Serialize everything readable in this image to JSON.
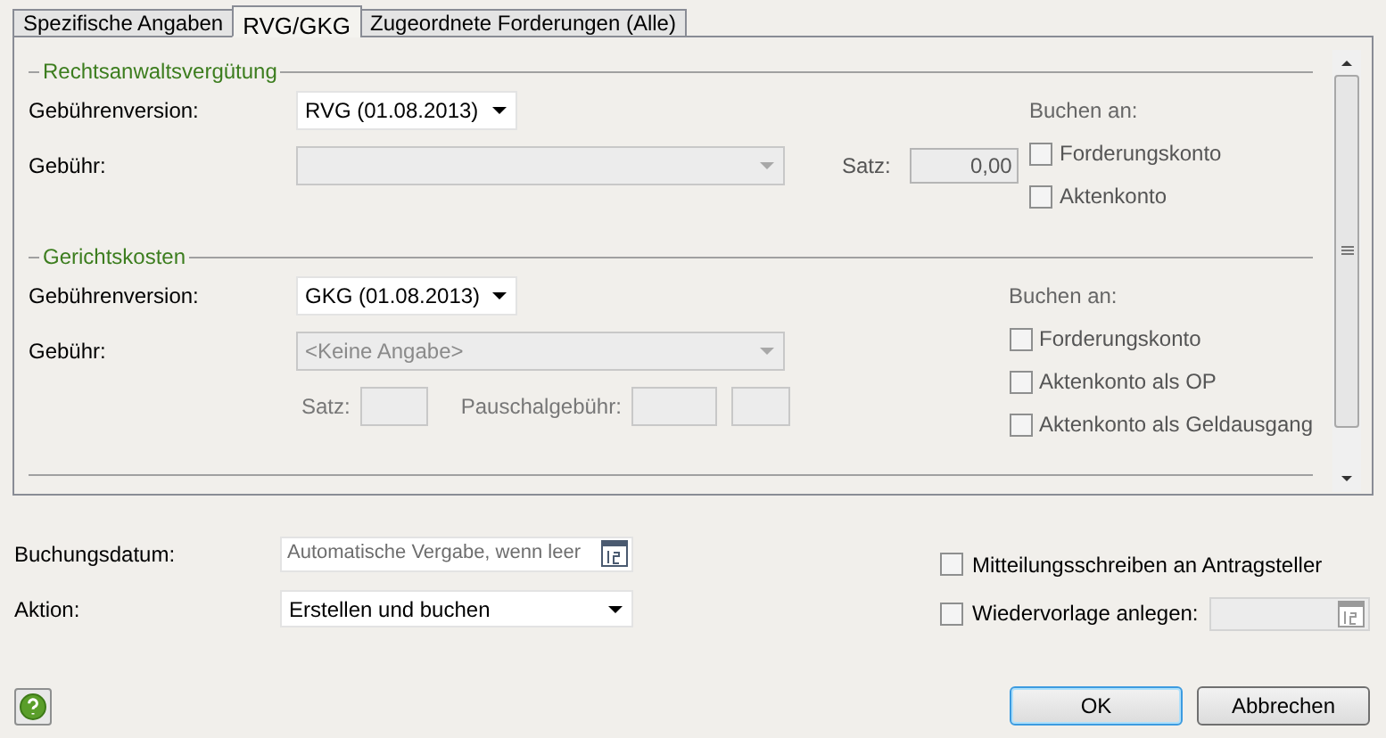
{
  "tabs": [
    {
      "label": "Spezifische Angaben",
      "selected": false
    },
    {
      "label": "RVG/GKG",
      "selected": true
    },
    {
      "label": "Zugeordnete Forderungen (Alle)",
      "selected": false
    }
  ],
  "sections": [
    {
      "title": "Rechtsanwaltsvergütung",
      "version_label": "Gebührenversion:",
      "version_value": "RVG (01.08.2013)",
      "fee_label": "Gebühr:",
      "fee_disabled": true,
      "kind": "rate",
      "rate_label": "Satz:",
      "rate_value": "0,00",
      "booking_label": "Buchen an:",
      "options": [
        {
          "label": "Forderungskonto",
          "checked": false
        },
        {
          "label": "Aktenkonto",
          "checked": false
        }
      ]
    },
    {
      "title": "Gerichtskosten",
      "version_label": "Gebührenversion:",
      "version_value": "GKG (01.08.2013)",
      "fee_label": "Gebühr:",
      "fee_value": "<Keine Angabe>",
      "fee_disabled": true,
      "kind": "rate_flat",
      "rate_label": "Satz:",
      "flat_label": "Pauschalgebühr:",
      "booking_label": "Buchen an:",
      "options": [
        {
          "label": "Forderungskonto",
          "checked": false
        },
        {
          "label": "Aktenkonto als OP",
          "checked": false
        },
        {
          "label": "Aktenkonto als Geldausgang",
          "checked": false
        }
      ]
    }
  ],
  "booking_date": {
    "label": "Buchungsdatum:",
    "placeholder": "Automatische Vergabe, wenn leer"
  },
  "action": {
    "label": "Aktion:",
    "value": "Erstellen und buchen"
  },
  "notify": {
    "label": "Mitteilungsschreiben an Antragsteller",
    "checked": false
  },
  "resubmit": {
    "label": "Wiedervorlage anlegen:",
    "checked": false,
    "disabled": true
  },
  "buttons": [
    {
      "label": "OK",
      "default": true
    },
    {
      "label": "Abbrechen",
      "default": false
    }
  ]
}
